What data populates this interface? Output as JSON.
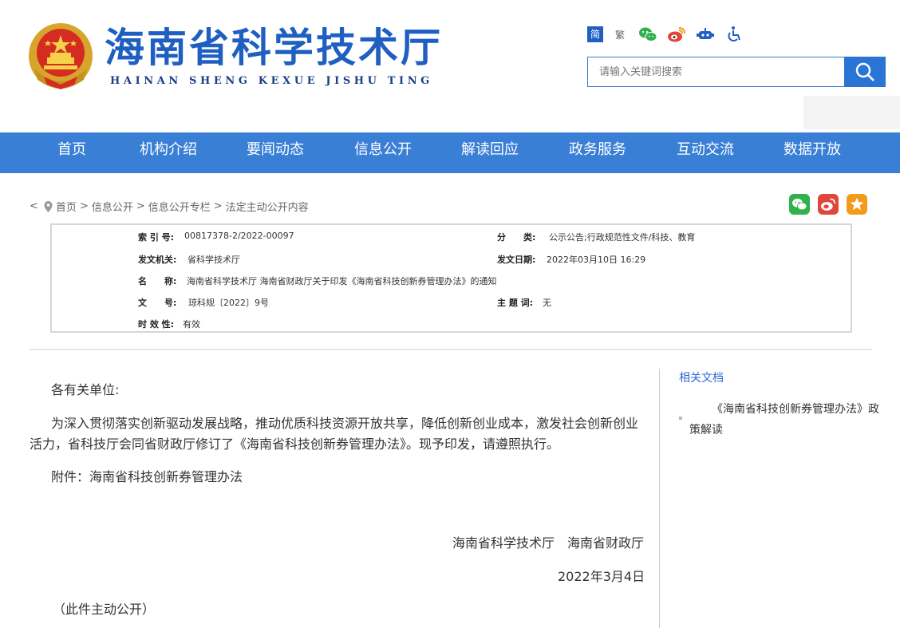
{
  "header": {
    "title": "海南省科学技术厅",
    "subtitle": "HAINAN SHENG KEXUE JISHU TING",
    "lang_simplified": "简",
    "lang_traditional": "繁",
    "search_placeholder": "请输入关键词搜索"
  },
  "nav": {
    "items": [
      "首页",
      "机构介绍",
      "要闻动态",
      "信息公开",
      "解读回应",
      "政务服务",
      "互动交流",
      "数据开放"
    ]
  },
  "breadcrumb": {
    "back": "<",
    "items": [
      "首页",
      "信息公开",
      "信息公开专栏",
      "法定主动公开内容"
    ],
    "sep": ">"
  },
  "info": {
    "index_label": "索 引 号:",
    "index_value": "00817378-2/2022-00097",
    "category_label": "分　　类:",
    "category_value": "公示公告;行政规范性文件/科技、教育",
    "issuer_label": "发文机关:",
    "issuer_value": "省科学技术厅",
    "date_label": "发文日期:",
    "date_value": "2022年03月10日 16:29",
    "name_label": "名　　称:",
    "name_value": "海南省科学技术厅 海南省财政厅关于印发《海南省科技创新券管理办法》的通知",
    "docno_label": "文　　号:",
    "docno_value": "琼科规〔2022〕9号",
    "keyword_label": "主 题 词:",
    "keyword_value": "无",
    "validity_label": "时 效 性:",
    "validity_value": "有效"
  },
  "article": {
    "salutation": "各有关单位:",
    "body_line1": "为深入贯彻落实创新驱动发展战略，推动优质科技资源开放共享，降低创新创业成本，激发社会创新创业",
    "body_line2": "活力，省科技厅会同省财政厅修订了《海南省科技创新券管理办法》。现予印发，请遵照执行。",
    "attachment": "附件：海南省科技创新券管理办法",
    "signature": "海南省科学技术厅　海南省财政厅",
    "date": "2022年3月4日",
    "note": "（此件主动公开）"
  },
  "sidebar": {
    "title": "相关文档",
    "doc": "《海南省科技创新券管理办法》政策解读"
  },
  "colors": {
    "brand_blue": "#1f5fc2",
    "nav_blue": "#3a7fd6",
    "wechat_green": "#2fb14b",
    "weibo_red": "#e0463a",
    "fav_orange": "#f29b1a"
  }
}
